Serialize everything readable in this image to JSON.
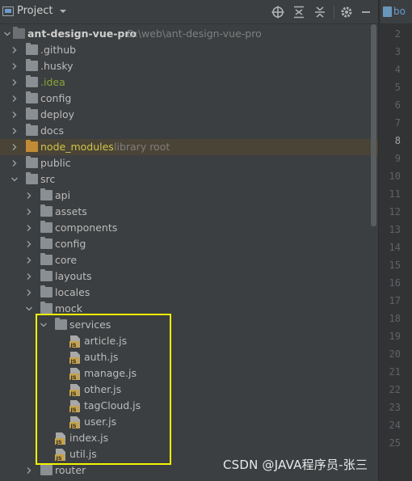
{
  "header": {
    "title": "Project",
    "editor_tab_label": "bo"
  },
  "tree": {
    "root": {
      "name": "ant-design-vue-pro",
      "path": "D:\\web\\ant-design-vue-pro"
    },
    "items": [
      {
        "name": ".github"
      },
      {
        "name": ".husky"
      },
      {
        "name": ".idea"
      },
      {
        "name": "config"
      },
      {
        "name": "deploy"
      },
      {
        "name": "docs"
      },
      {
        "name": "node_modules",
        "hint": "library root"
      },
      {
        "name": "public"
      },
      {
        "name": "src"
      },
      {
        "name": "api"
      },
      {
        "name": "assets"
      },
      {
        "name": "components"
      },
      {
        "name": "config"
      },
      {
        "name": "core"
      },
      {
        "name": "layouts"
      },
      {
        "name": "locales"
      },
      {
        "name": "mock"
      },
      {
        "name": "services"
      },
      {
        "name": "article.js"
      },
      {
        "name": "auth.js"
      },
      {
        "name": "manage.js"
      },
      {
        "name": "other.js"
      },
      {
        "name": "tagCloud.js"
      },
      {
        "name": "user.js"
      },
      {
        "name": "index.js"
      },
      {
        "name": "util.js"
      },
      {
        "name": "router"
      }
    ]
  },
  "gutter": {
    "line_numbers": [
      "2",
      "3",
      "4",
      "5",
      "6",
      "7",
      "8",
      "9",
      "10",
      "11",
      "12",
      "13",
      "14",
      "15",
      "16",
      "17",
      "18",
      "19",
      "20",
      "21",
      "22",
      "23",
      "24",
      "25"
    ],
    "current_line": "8"
  },
  "watermark": "CSDN @JAVA程序员-张三",
  "colors": {
    "annotation_box": "#f5f500",
    "highlight_row": "#4a4436",
    "ignored_text": "#d0c44a"
  }
}
